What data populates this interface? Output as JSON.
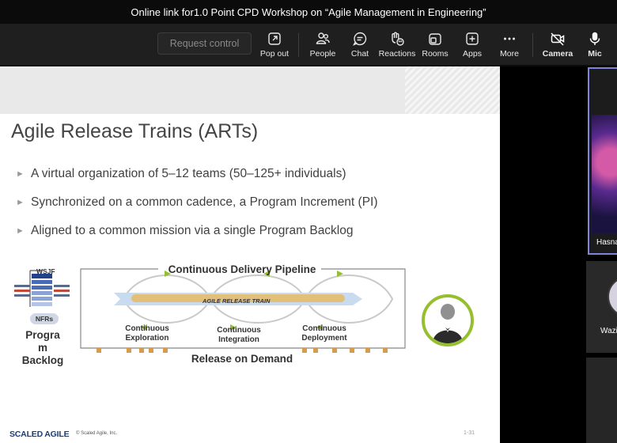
{
  "window": {
    "title": "Online link for1.0 Point CPD Workshop on “Agile Management in Engineering”"
  },
  "toolbar": {
    "request_control": "Request control",
    "items": [
      {
        "label": "Pop out",
        "icon": "pop-out-icon"
      },
      {
        "label": "People",
        "icon": "people-icon"
      },
      {
        "label": "Chat",
        "icon": "chat-icon"
      },
      {
        "label": "Reactions",
        "icon": "reactions-icon"
      },
      {
        "label": "Rooms",
        "icon": "rooms-icon"
      },
      {
        "label": "Apps",
        "icon": "apps-icon"
      },
      {
        "label": "More",
        "icon": "more-icon"
      },
      {
        "label": "Camera",
        "icon": "camera-off-icon"
      },
      {
        "label": "Mic",
        "icon": "mic-icon"
      }
    ]
  },
  "slide": {
    "title": "Agile Release Trains (ARTs)",
    "bullets": [
      "A virtual organization of 5–12 teams (50–125+ individuals)",
      "Synchronized on a common cadence, a Program Increment (PI)",
      "Aligned to a common mission via a single Program Backlog"
    ],
    "diagram": {
      "backlog_wsjf": "WSJF",
      "backlog_nfrs": "NFRs",
      "backlog_label": "Progra\nm\nBacklog",
      "pipeline_title": "Continuous Delivery Pipeline",
      "train_label": "AGILE RELEASE TRAIN",
      "stage_exploration": "Continuous\nExploration",
      "stage_integration": "Continuous\nIntegration",
      "stage_deployment": "Continuous\nDeployment",
      "release_label": "Release on Demand"
    },
    "footer": {
      "logo": "SCALED AGILE",
      "copyright": "© Scaled Agile, Inc.",
      "page": "1-31"
    }
  },
  "participants": [
    {
      "name": "Hasna"
    },
    {
      "name": "Wazi"
    }
  ],
  "colors": {
    "toolbar_bg": "#1f1f1f",
    "active_speaker_border": "#7f85d9",
    "customer_ring": "#96bf2f",
    "train_gold": "#e3c07a"
  }
}
